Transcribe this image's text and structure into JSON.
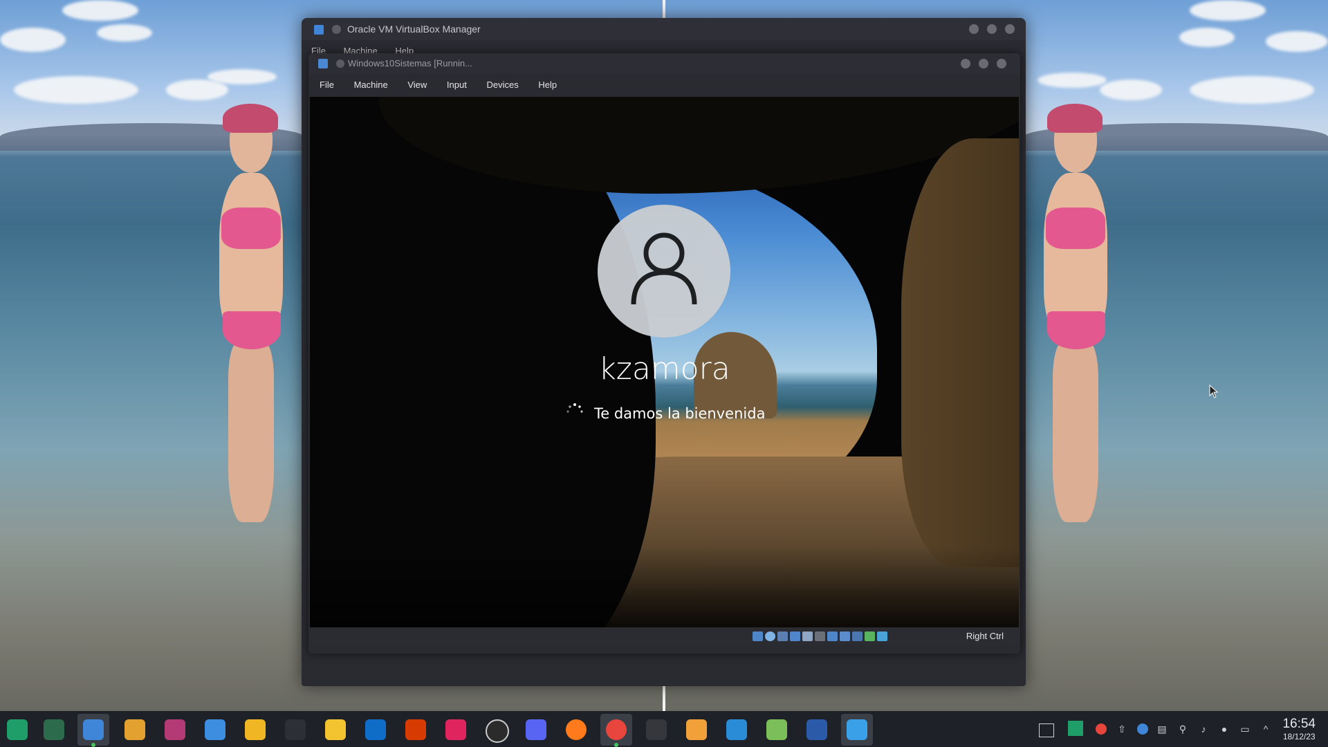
{
  "manager_window": {
    "title": "Oracle VM VirtualBox Manager",
    "menu": [
      "File",
      "Machine",
      "Help"
    ]
  },
  "vm_window": {
    "title": "Windows10Sistemas [Runnin...",
    "menu": [
      "File",
      "Machine",
      "View",
      "Input",
      "Devices",
      "Help"
    ],
    "host_key": "Right Ctrl"
  },
  "guest": {
    "username": "kzamora",
    "welcome_text": "Te damos la bienvenida"
  },
  "taskbar": {
    "time": "16:54",
    "date": "18/12/23"
  },
  "colors": {
    "taskbar_bg": "#1e2128",
    "window_bg": "#2a2b31",
    "running_indicator": "#47c45d"
  }
}
